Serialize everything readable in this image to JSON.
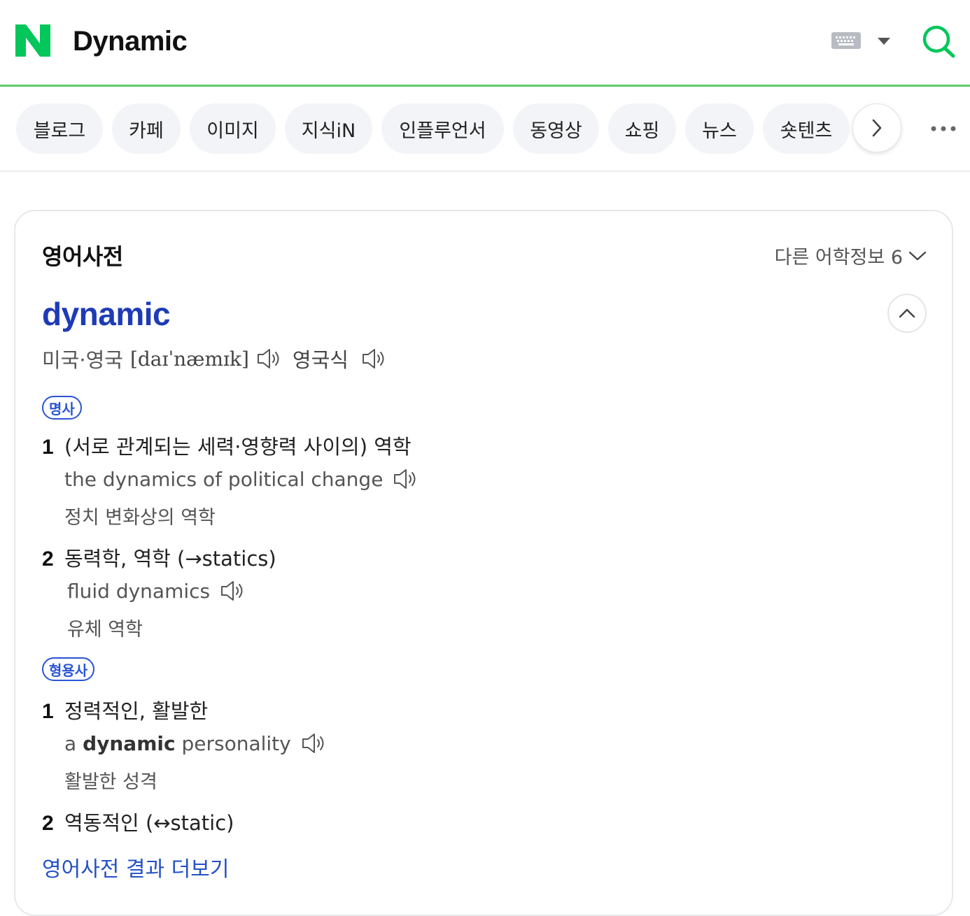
{
  "header": {
    "logo_letter": "N",
    "query": "Dynamic",
    "icons": {
      "keyboard": "keyboard-icon",
      "dropdown": "caret-down-icon",
      "search": "search-icon"
    },
    "brand_color": "#03c75a"
  },
  "tabs": [
    "블로그",
    "카페",
    "이미지",
    "지식iN",
    "인플루언서",
    "동영상",
    "쇼핑",
    "뉴스",
    "숏텐츠"
  ],
  "dictionary": {
    "title": "영어사전",
    "other_info_label": "다른 어학정보 6",
    "headword": "dynamic",
    "pronunciation": {
      "region": "미국·영국",
      "ipa": "[daɪˈnæmɪk]",
      "uk_label": "영국식"
    },
    "pos": [
      {
        "label": "명사",
        "senses": [
          {
            "num": "1",
            "meaning": "(서로 관계되는 세력·영향력 사이의) 역학",
            "example": "the dynamics of political change",
            "translation": "정치 변화상의 역학"
          },
          {
            "num": "2",
            "meaning": "동력학, 역학 (→statics)",
            "example": "fluid dynamics",
            "translation": "유체 역학"
          }
        ]
      },
      {
        "label": "형용사",
        "senses": [
          {
            "num": "1",
            "meaning": "정력적인, 활발한",
            "example_prefix": "a",
            "example_bold": "dynamic",
            "example_suffix": "personality",
            "translation": "활발한 성격"
          },
          {
            "num": "2",
            "meaning": "역동적인 (↔static)"
          }
        ]
      }
    ],
    "more_link": "영어사전 결과 더보기",
    "colors": {
      "headword": "#1e3bb6",
      "badge": "#2954d6",
      "link": "#2451c7"
    }
  }
}
